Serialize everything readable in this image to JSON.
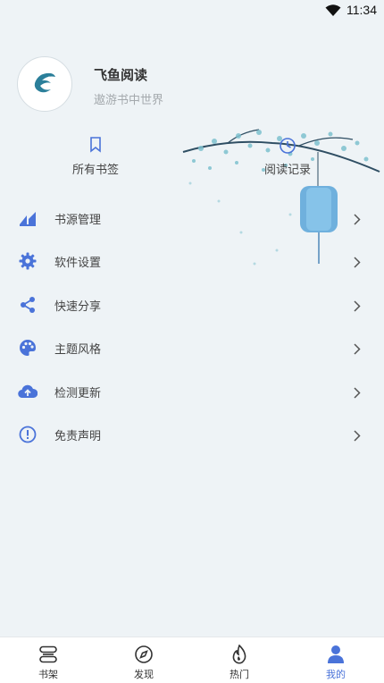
{
  "status_bar": {
    "time": "11:34",
    "wifi_icon": "wifi-icon"
  },
  "profile": {
    "app_name": "飞鱼阅读",
    "slogan": "遨游书中世界",
    "avatar_icon": "app-logo-icon"
  },
  "shortcuts": [
    {
      "label": "所有书签",
      "icon": "bookmark-icon"
    },
    {
      "label": "阅读记录",
      "icon": "clock-icon"
    }
  ],
  "menu": {
    "items": [
      {
        "label": "书源管理",
        "icon": "book-source-icon"
      },
      {
        "label": "软件设置",
        "icon": "gear-icon"
      },
      {
        "label": "快速分享",
        "icon": "share-icon"
      },
      {
        "label": "主题风格",
        "icon": "palette-icon"
      },
      {
        "label": "检测更新",
        "icon": "cloud-upload-icon"
      },
      {
        "label": "免责声明",
        "icon": "info-icon"
      }
    ]
  },
  "bottom_nav": {
    "items": [
      {
        "label": "书架",
        "icon": "bookshelf-icon",
        "active": false
      },
      {
        "label": "发现",
        "icon": "compass-icon",
        "active": false
      },
      {
        "label": "热门",
        "icon": "flame-icon",
        "active": false
      },
      {
        "label": "我的",
        "icon": "person-icon",
        "active": true
      }
    ]
  },
  "colors": {
    "accent": "#4a73d9",
    "background": "#eef3f6",
    "text_primary": "#333333",
    "text_secondary": "#a4a9ad"
  }
}
